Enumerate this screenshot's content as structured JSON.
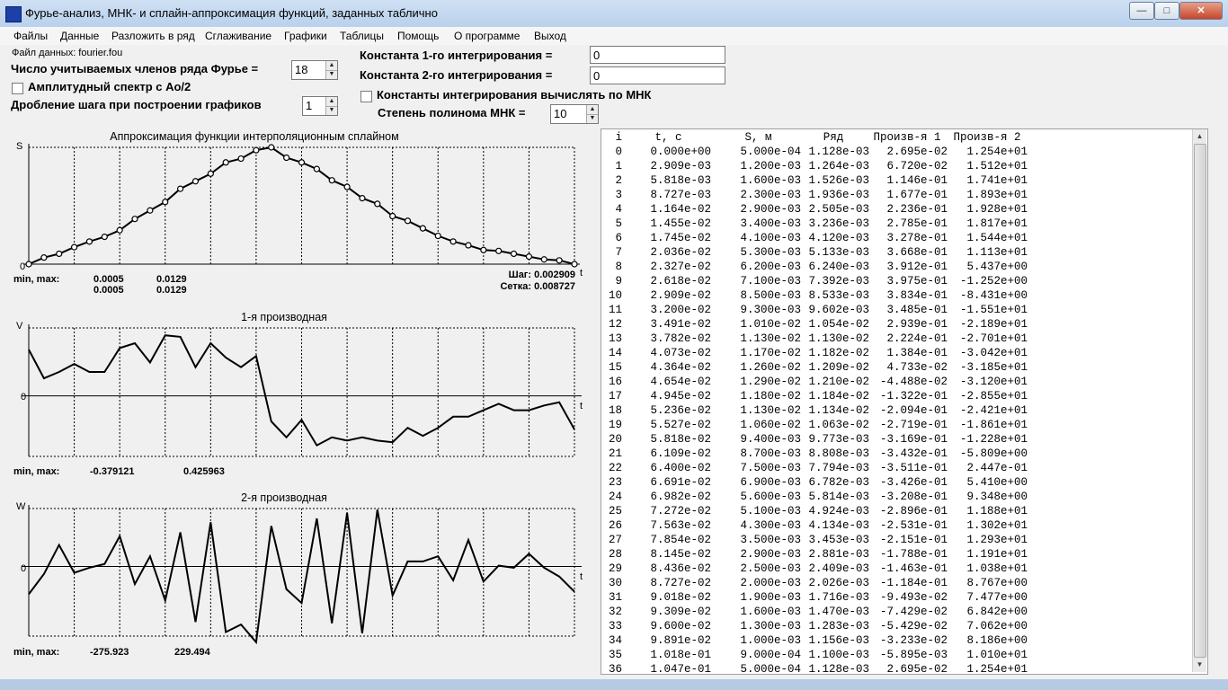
{
  "window": {
    "title": "Фурье-анализ, МНК- и сплайн-аппроксимация функций, заданных таблично",
    "min_glyph": "—",
    "max_glyph": "□",
    "close_glyph": "✕"
  },
  "menu": [
    "Файлы",
    "Данные",
    "Разложить в ряд",
    "Сглаживание",
    "Графики",
    "Таблицы",
    "Помощь",
    "О программе",
    "Выход"
  ],
  "controls": {
    "file_label": "Файл данных: fourier.fou",
    "fourier_terms_label": "Число учитываемых членов ряда Фурье =",
    "fourier_terms_value": "18",
    "amplitude_spectrum_label": "Амплитудный спектр с Ao/2",
    "step_split_label": "Дробление шага при построении графиков",
    "step_split_value": "1",
    "const1_label": "Константа 1-го интегрирования =",
    "const1_value": "0",
    "const2_label": "Константа 2-го интегрирования =",
    "const2_value": "0",
    "mnk_constants_label": "Константы интегрирования вычислять по МНК",
    "poly_degree_label": "Степень полинома МНК =",
    "poly_degree_value": "10"
  },
  "charts": {
    "spline": {
      "title": "Аппроксимация функции интерполяционным сплайном",
      "y_axis_letter": "S",
      "x_axis_letter": "t",
      "zero_label": "0",
      "minmax_label": "min, max:",
      "min1": "0.0005",
      "max1": "0.0129",
      "min2": "0.0005",
      "max2": "0.0129",
      "step_text": "Шаг: 0.002909",
      "grid_text": "Сетка: 0.008727"
    },
    "deriv1": {
      "title": "1-я производная",
      "y_axis_letter": "V",
      "x_axis_letter": "t",
      "zero_label": "0",
      "minmax_label": "min, max:",
      "min": "-0.379121",
      "max": "0.425963"
    },
    "deriv2": {
      "title": "2-я производная",
      "y_axis_letter": "W",
      "x_axis_letter": "t",
      "zero_label": "0",
      "minmax_label": "min, max:",
      "min": "-275.923",
      "max": "229.494"
    }
  },
  "table": {
    "headers": [
      "i",
      "t, c",
      "S, м",
      "Ряд",
      "Произв-я 1",
      "Произв-я 2"
    ],
    "rows": [
      [
        "0",
        "0.000e+00",
        "5.000e-04",
        "1.128e-03",
        "2.695e-02",
        "1.254e+01"
      ],
      [
        "1",
        "2.909e-03",
        "1.200e-03",
        "1.264e-03",
        "6.720e-02",
        "1.512e+01"
      ],
      [
        "2",
        "5.818e-03",
        "1.600e-03",
        "1.526e-03",
        "1.146e-01",
        "1.741e+01"
      ],
      [
        "3",
        "8.727e-03",
        "2.300e-03",
        "1.936e-03",
        "1.677e-01",
        "1.893e+01"
      ],
      [
        "4",
        "1.164e-02",
        "2.900e-03",
        "2.505e-03",
        "2.236e-01",
        "1.928e+01"
      ],
      [
        "5",
        "1.455e-02",
        "3.400e-03",
        "3.236e-03",
        "2.785e-01",
        "1.817e+01"
      ],
      [
        "6",
        "1.745e-02",
        "4.100e-03",
        "4.120e-03",
        "3.278e-01",
        "1.544e+01"
      ],
      [
        "7",
        "2.036e-02",
        "5.300e-03",
        "5.133e-03",
        "3.668e-01",
        "1.113e+01"
      ],
      [
        "8",
        "2.327e-02",
        "6.200e-03",
        "6.240e-03",
        "3.912e-01",
        "5.437e+00"
      ],
      [
        "9",
        "2.618e-02",
        "7.100e-03",
        "7.392e-03",
        "3.975e-01",
        "-1.252e+00"
      ],
      [
        "10",
        "2.909e-02",
        "8.500e-03",
        "8.533e-03",
        "3.834e-01",
        "-8.431e+00"
      ],
      [
        "11",
        "3.200e-02",
        "9.300e-03",
        "9.602e-03",
        "3.485e-01",
        "-1.551e+01"
      ],
      [
        "12",
        "3.491e-02",
        "1.010e-02",
        "1.054e-02",
        "2.939e-01",
        "-2.189e+01"
      ],
      [
        "13",
        "3.782e-02",
        "1.130e-02",
        "1.130e-02",
        "2.224e-01",
        "-2.701e+01"
      ],
      [
        "14",
        "4.073e-02",
        "1.170e-02",
        "1.182e-02",
        "1.384e-01",
        "-3.042e+01"
      ],
      [
        "15",
        "4.364e-02",
        "1.260e-02",
        "1.209e-02",
        "4.733e-02",
        "-3.185e+01"
      ],
      [
        "16",
        "4.654e-02",
        "1.290e-02",
        "1.210e-02",
        "-4.488e-02",
        "-3.120e+01"
      ],
      [
        "17",
        "4.945e-02",
        "1.180e-02",
        "1.184e-02",
        "-1.322e-01",
        "-2.855e+01"
      ],
      [
        "18",
        "5.236e-02",
        "1.130e-02",
        "1.134e-02",
        "-2.094e-01",
        "-2.421e+01"
      ],
      [
        "19",
        "5.527e-02",
        "1.060e-02",
        "1.063e-02",
        "-2.719e-01",
        "-1.861e+01"
      ],
      [
        "20",
        "5.818e-02",
        "9.400e-03",
        "9.773e-03",
        "-3.169e-01",
        "-1.228e+01"
      ],
      [
        "21",
        "6.109e-02",
        "8.700e-03",
        "8.808e-03",
        "-3.432e-01",
        "-5.809e+00"
      ],
      [
        "22",
        "6.400e-02",
        "7.500e-03",
        "7.794e-03",
        "-3.511e-01",
        "2.447e-01"
      ],
      [
        "23",
        "6.691e-02",
        "6.900e-03",
        "6.782e-03",
        "-3.426e-01",
        "5.410e+00"
      ],
      [
        "24",
        "6.982e-02",
        "5.600e-03",
        "5.814e-03",
        "-3.208e-01",
        "9.348e+00"
      ],
      [
        "25",
        "7.272e-02",
        "5.100e-03",
        "4.924e-03",
        "-2.896e-01",
        "1.188e+01"
      ],
      [
        "26",
        "7.563e-02",
        "4.300e-03",
        "4.134e-03",
        "-2.531e-01",
        "1.302e+01"
      ],
      [
        "27",
        "7.854e-02",
        "3.500e-03",
        "3.453e-03",
        "-2.151e-01",
        "1.293e+01"
      ],
      [
        "28",
        "8.145e-02",
        "2.900e-03",
        "2.881e-03",
        "-1.788e-01",
        "1.191e+01"
      ],
      [
        "29",
        "8.436e-02",
        "2.500e-03",
        "2.409e-03",
        "-1.463e-01",
        "1.038e+01"
      ],
      [
        "30",
        "8.727e-02",
        "2.000e-03",
        "2.026e-03",
        "-1.184e-01",
        "8.767e+00"
      ],
      [
        "31",
        "9.018e-02",
        "1.900e-03",
        "1.716e-03",
        "-9.493e-02",
        "7.477e+00"
      ],
      [
        "32",
        "9.309e-02",
        "1.600e-03",
        "1.470e-03",
        "-7.429e-02",
        "6.842e+00"
      ],
      [
        "33",
        "9.600e-02",
        "1.300e-03",
        "1.283e-03",
        "-5.429e-02",
        "7.062e+00"
      ],
      [
        "34",
        "9.891e-02",
        "1.000e-03",
        "1.156e-03",
        "-3.233e-02",
        "8.186e+00"
      ],
      [
        "35",
        "1.018e-01",
        "9.000e-04",
        "1.100e-03",
        "-5.895e-03",
        "1.010e+01"
      ],
      [
        "36",
        "1.047e-01",
        "5.000e-04",
        "1.128e-03",
        "2.695e-02",
        "1.254e+01"
      ]
    ]
  },
  "chart_data": [
    {
      "type": "line",
      "title": "Аппроксимация функции интерполяционным сплайном",
      "xlabel": "t",
      "ylabel": "S",
      "x": [
        0,
        0.002909,
        0.005818,
        0.008727,
        0.01164,
        0.01455,
        0.01745,
        0.02036,
        0.02327,
        0.02618,
        0.02909,
        0.032,
        0.03491,
        0.03782,
        0.04073,
        0.04364,
        0.04654,
        0.04945,
        0.05236,
        0.05527,
        0.05818,
        0.06109,
        0.064,
        0.06691,
        0.06982,
        0.07272,
        0.07563,
        0.07854,
        0.08145,
        0.08436,
        0.08727,
        0.09018,
        0.09309,
        0.096,
        0.09891,
        0.1018,
        0.1047
      ],
      "series": [
        {
          "markers": true,
          "values": [
            0.0005,
            0.0012,
            0.0016,
            0.0023,
            0.0029,
            0.0034,
            0.0041,
            0.0053,
            0.0062,
            0.0071,
            0.0085,
            0.0093,
            0.0101,
            0.0113,
            0.0117,
            0.0126,
            0.0129,
            0.0118,
            0.0113,
            0.0106,
            0.0094,
            0.0087,
            0.0075,
            0.0069,
            0.0056,
            0.0051,
            0.0043,
            0.0035,
            0.0029,
            0.0025,
            0.002,
            0.0019,
            0.0016,
            0.0013,
            0.001,
            0.0009,
            0.0005
          ]
        }
      ],
      "ylim": [
        0.0005,
        0.0129
      ],
      "grid": true
    },
    {
      "type": "line",
      "title": "1-я производная",
      "xlabel": "t",
      "ylabel": "V",
      "x": [
        0,
        0.002909,
        0.005818,
        0.008727,
        0.01164,
        0.01455,
        0.01745,
        0.02036,
        0.02327,
        0.02618,
        0.02909,
        0.032,
        0.03491,
        0.03782,
        0.04073,
        0.04364,
        0.04654,
        0.04945,
        0.05236,
        0.05527,
        0.05818,
        0.06109,
        0.064,
        0.06691,
        0.06982,
        0.07272,
        0.07563,
        0.07854,
        0.08145,
        0.08436,
        0.08727,
        0.09018,
        0.09309,
        0.096,
        0.09891,
        0.1018,
        0.1047
      ],
      "series": [
        {
          "values": [
            0.29,
            0.11,
            0.15,
            0.2,
            0.15,
            0.15,
            0.3,
            0.33,
            0.21,
            0.38,
            0.37,
            0.18,
            0.33,
            0.24,
            0.18,
            0.25,
            -0.16,
            -0.26,
            -0.15,
            -0.31,
            -0.26,
            -0.28,
            -0.26,
            -0.28,
            -0.29,
            -0.2,
            -0.25,
            -0.2,
            -0.13,
            -0.13,
            -0.09,
            -0.05,
            -0.09,
            -0.09,
            -0.06,
            -0.04,
            -0.21
          ]
        }
      ],
      "ylim": [
        -0.379121,
        0.425963
      ],
      "grid": true
    },
    {
      "type": "line",
      "title": "2-я производная",
      "xlabel": "t",
      "ylabel": "W",
      "x": [
        0,
        0.002909,
        0.005818,
        0.008727,
        0.01164,
        0.01455,
        0.01745,
        0.02036,
        0.02327,
        0.02618,
        0.02909,
        0.032,
        0.03491,
        0.03782,
        0.04073,
        0.04364,
        0.04654,
        0.04945,
        0.05236,
        0.05527,
        0.05818,
        0.06109,
        0.064,
        0.06691,
        0.06982,
        0.07272,
        0.07563,
        0.07854,
        0.08145,
        0.08436,
        0.08727,
        0.09018,
        0.09309,
        0.096,
        0.09891,
        0.1018,
        0.1047
      ],
      "series": [
        {
          "values": [
            -110,
            -30,
            85,
            -25,
            -5,
            10,
            120,
            -70,
            40,
            -135,
            135,
            -220,
            175,
            -260,
            -230,
            -300,
            160,
            -90,
            -145,
            190,
            -225,
            212,
            -265,
            225,
            -115,
            20,
            20,
            40,
            -55,
            105,
            -60,
            3,
            -5,
            50,
            -5,
            -40,
            -100
          ]
        }
      ],
      "ylim": [
        -275.923,
        229.494
      ],
      "grid": true
    }
  ]
}
